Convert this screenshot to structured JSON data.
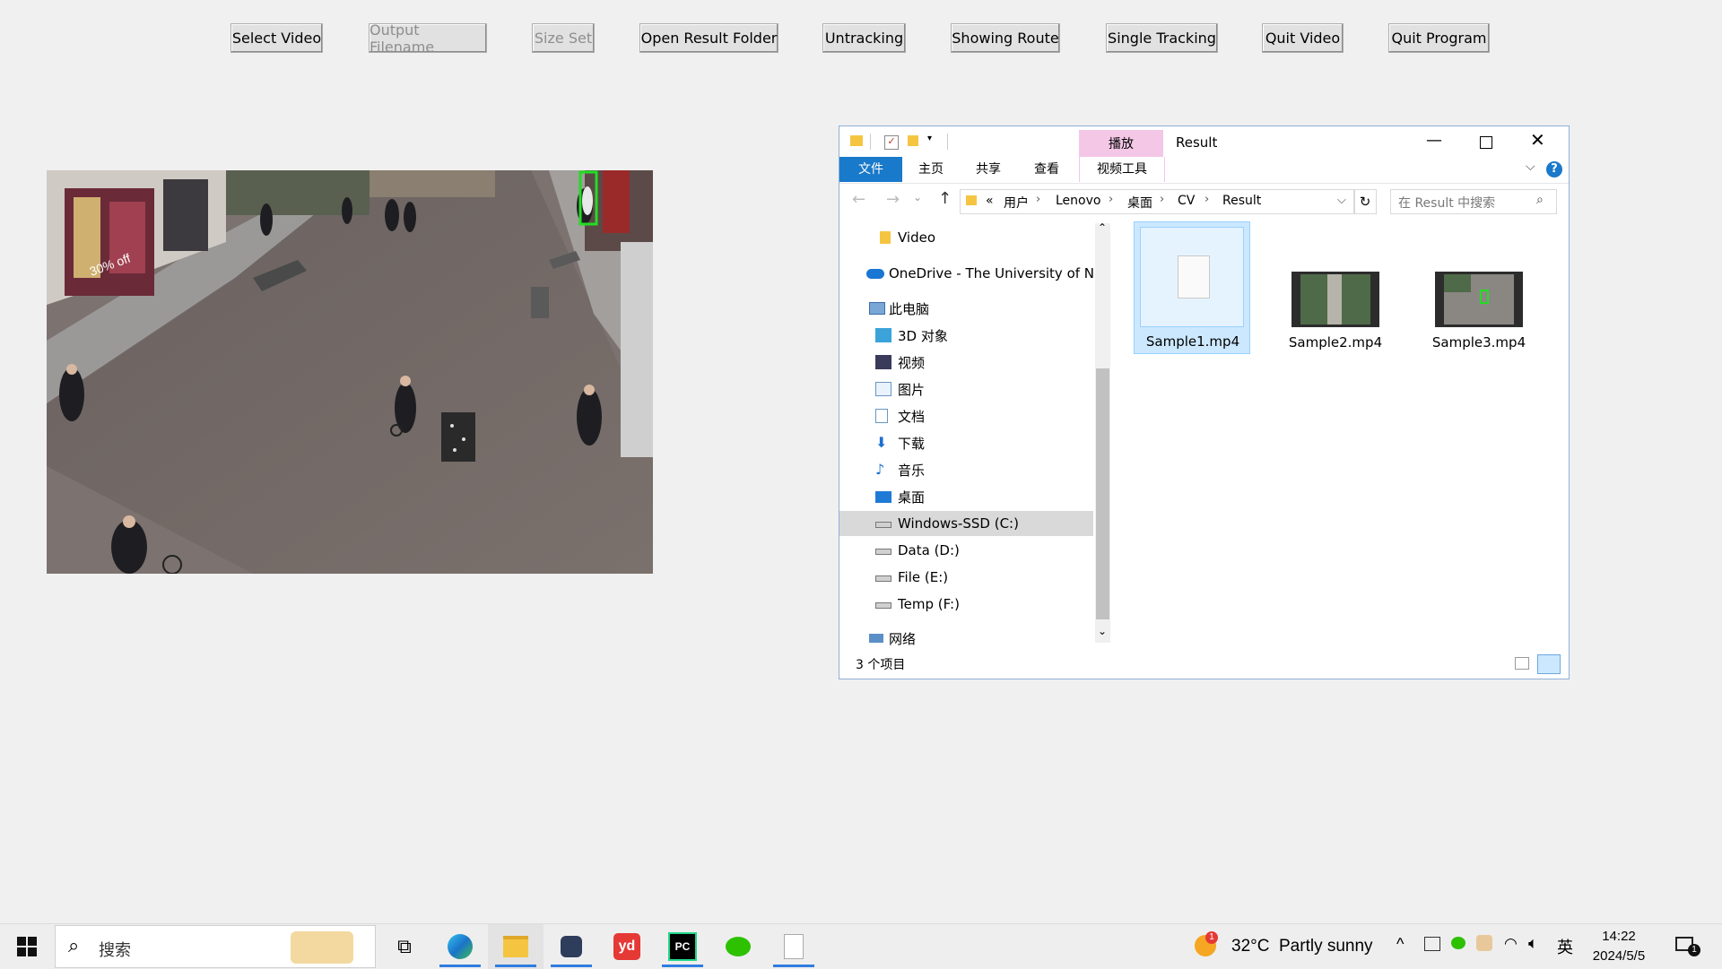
{
  "app_buttons": [
    {
      "label": "Select Video",
      "enabled": true
    },
    {
      "label": "Output Filename",
      "enabled": false
    },
    {
      "label": "Size Set",
      "enabled": false
    },
    {
      "label": "Open Result Folder",
      "enabled": true
    },
    {
      "label": "Untracking",
      "enabled": true
    },
    {
      "label": "Showing Route",
      "enabled": true
    },
    {
      "label": "Single Tracking",
      "enabled": true
    },
    {
      "label": "Quit Video",
      "enabled": true
    },
    {
      "label": "Quit Program",
      "enabled": true
    }
  ],
  "video": {
    "overlay_text": "30% off",
    "tracking_box_color": "#22dd22"
  },
  "explorer": {
    "title": "Result",
    "context_tab": "播放",
    "ribbon_tabs": [
      "文件",
      "主页",
      "共享",
      "查看",
      "视频工具"
    ],
    "breadcrumb": {
      "prefix": "«",
      "parts": [
        "用户",
        "Lenovo",
        "桌面",
        "CV",
        "Result"
      ]
    },
    "search_placeholder": "在 Result 中搜索",
    "nav": [
      {
        "label": "Video",
        "icon": "folder-icon"
      },
      {
        "label": "OneDrive - The University of No",
        "icon": "onedrive-icon"
      },
      {
        "label": "此电脑",
        "icon": "this-pc-icon"
      },
      {
        "label": "3D 对象",
        "icon": "3d-objects-icon"
      },
      {
        "label": "视频",
        "icon": "videos-folder-icon"
      },
      {
        "label": "图片",
        "icon": "pictures-folder-icon"
      },
      {
        "label": "文档",
        "icon": "documents-folder-icon"
      },
      {
        "label": "下载",
        "icon": "downloads-folder-icon"
      },
      {
        "label": "音乐",
        "icon": "music-folder-icon"
      },
      {
        "label": "桌面",
        "icon": "desktop-folder-icon"
      },
      {
        "label": "Windows-SSD (C:)",
        "icon": "drive-c-icon"
      },
      {
        "label": "Data (D:)",
        "icon": "drive-icon"
      },
      {
        "label": "File (E:)",
        "icon": "drive-icon"
      },
      {
        "label": "Temp (F:)",
        "icon": "drive-icon"
      },
      {
        "label": "网络",
        "icon": "network-icon"
      }
    ],
    "files": [
      {
        "name": "Sample1.mp4",
        "thumbnail": "blank-file-icon",
        "selected": true
      },
      {
        "name": "Sample2.mp4",
        "thumbnail": "video-thumbnail",
        "selected": false
      },
      {
        "name": "Sample3.mp4",
        "thumbnail": "video-thumbnail",
        "selected": false
      }
    ],
    "status": "3 个项目"
  },
  "taskbar": {
    "search_placeholder": "搜索",
    "weather": "32°C  Partly sunny",
    "weather_badge": "1",
    "ime": "英",
    "time": "14:22",
    "date": "2024/5/5",
    "notification_badge": "1",
    "apps": [
      "edge-icon",
      "file-explorer-icon",
      "cat-app-icon",
      "youdao-icon",
      "pycharm-icon",
      "wechat-icon",
      "blank-document-icon"
    ]
  },
  "colors": {
    "accent": "#0063b1",
    "context_tab": "#f4c7e6",
    "selection": "#cce8ff",
    "nav_selected": "#d9d9d9"
  }
}
